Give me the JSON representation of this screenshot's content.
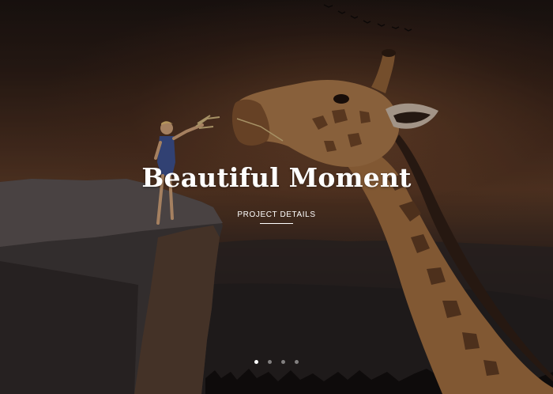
{
  "slide": {
    "title": "Beautiful Moment",
    "cta_label": "PROJECT DETAILS"
  },
  "slider": {
    "total_slides": 4,
    "active_index": 0,
    "dots": [
      {
        "label": "Slide 1"
      },
      {
        "label": "Slide 2"
      },
      {
        "label": "Slide 3"
      },
      {
        "label": "Slide 4"
      }
    ]
  },
  "colors": {
    "text": "#ffffff",
    "sky_top": "#1a1311",
    "sky_glow": "#5a3a26",
    "giraffe": "#a07445",
    "cliff": "#4a4444"
  }
}
